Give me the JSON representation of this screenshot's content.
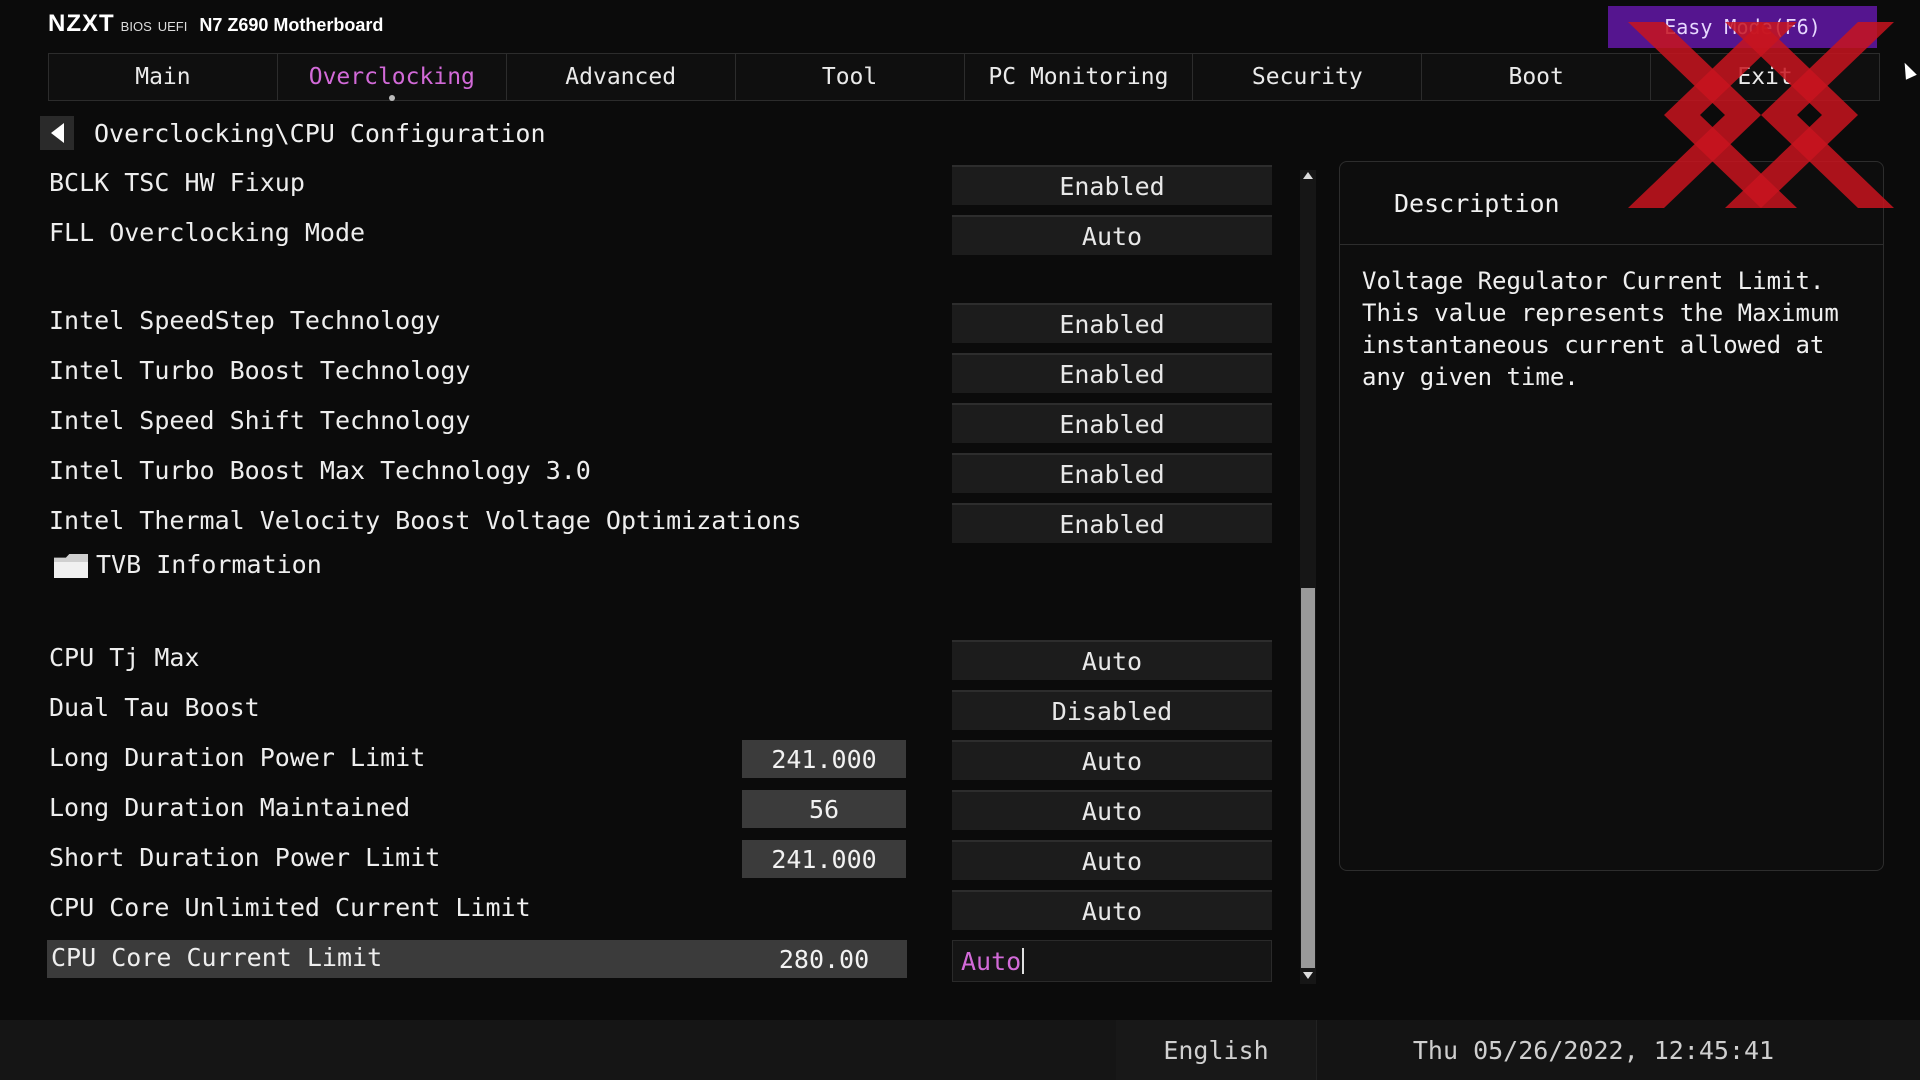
{
  "header": {
    "brand_logo": "NZXT",
    "brand_bios": "BIOS",
    "brand_uefi": "UEFI",
    "board_name": "N7 Z690 Motherboard",
    "easy_mode_label": "Easy Mode(F6)"
  },
  "tabs": [
    {
      "label": "Main",
      "active": false
    },
    {
      "label": "Overclocking",
      "active": true
    },
    {
      "label": "Advanced",
      "active": false
    },
    {
      "label": "Tool",
      "active": false
    },
    {
      "label": "PC Monitoring",
      "active": false
    },
    {
      "label": "Security",
      "active": false
    },
    {
      "label": "Boot",
      "active": false
    },
    {
      "label": "Exit",
      "active": false
    }
  ],
  "breadcrumb": "Overclocking\\CPU Configuration",
  "settings": [
    {
      "label": "BCLK TSC HW Fixup",
      "value": "Enabled"
    },
    {
      "label": "FLL Overclocking Mode",
      "value": "Auto"
    },
    {
      "label": "Intel SpeedStep Technology",
      "value": "Enabled"
    },
    {
      "label": "Intel Turbo Boost Technology",
      "value": "Enabled"
    },
    {
      "label": "Intel Speed Shift Technology",
      "value": "Enabled"
    },
    {
      "label": "Intel Turbo Boost Max Technology 3.0",
      "value": "Enabled"
    },
    {
      "label": "Intel Thermal Velocity Boost Voltage Optimizations",
      "value": "Enabled"
    },
    {
      "label": "TVB Information"
    },
    {
      "label": "CPU Tj Max",
      "value": "Auto"
    },
    {
      "label": "Dual Tau Boost",
      "value": "Disabled"
    },
    {
      "label": "Long Duration Power Limit",
      "current": "241.000",
      "value": "Auto"
    },
    {
      "label": "Long Duration Maintained",
      "current": "56",
      "value": "Auto"
    },
    {
      "label": "Short Duration Power Limit",
      "current": "241.000",
      "value": "Auto"
    },
    {
      "label": "CPU Core Unlimited Current Limit",
      "value": "Auto"
    },
    {
      "label": "CPU Core Current Limit",
      "current": "280.00",
      "value": "Auto",
      "selected": true
    }
  ],
  "description": {
    "title": "Description",
    "text": "Voltage Regulator Current Limit. This value represents the Maximum instantaneous current allowed at any given time."
  },
  "footer": {
    "language": "English",
    "datetime": "Thu 05/26/2022, 12:45:41"
  },
  "colors": {
    "accent": "#d26ad8",
    "easy_mode_bg": "#55158f",
    "watermark": "#c8141e"
  },
  "icons": [
    "back-arrow-icon",
    "folder-icon",
    "scroll-up-icon",
    "scroll-down-icon",
    "mouse-cursor-icon",
    "watermark-logo"
  ]
}
